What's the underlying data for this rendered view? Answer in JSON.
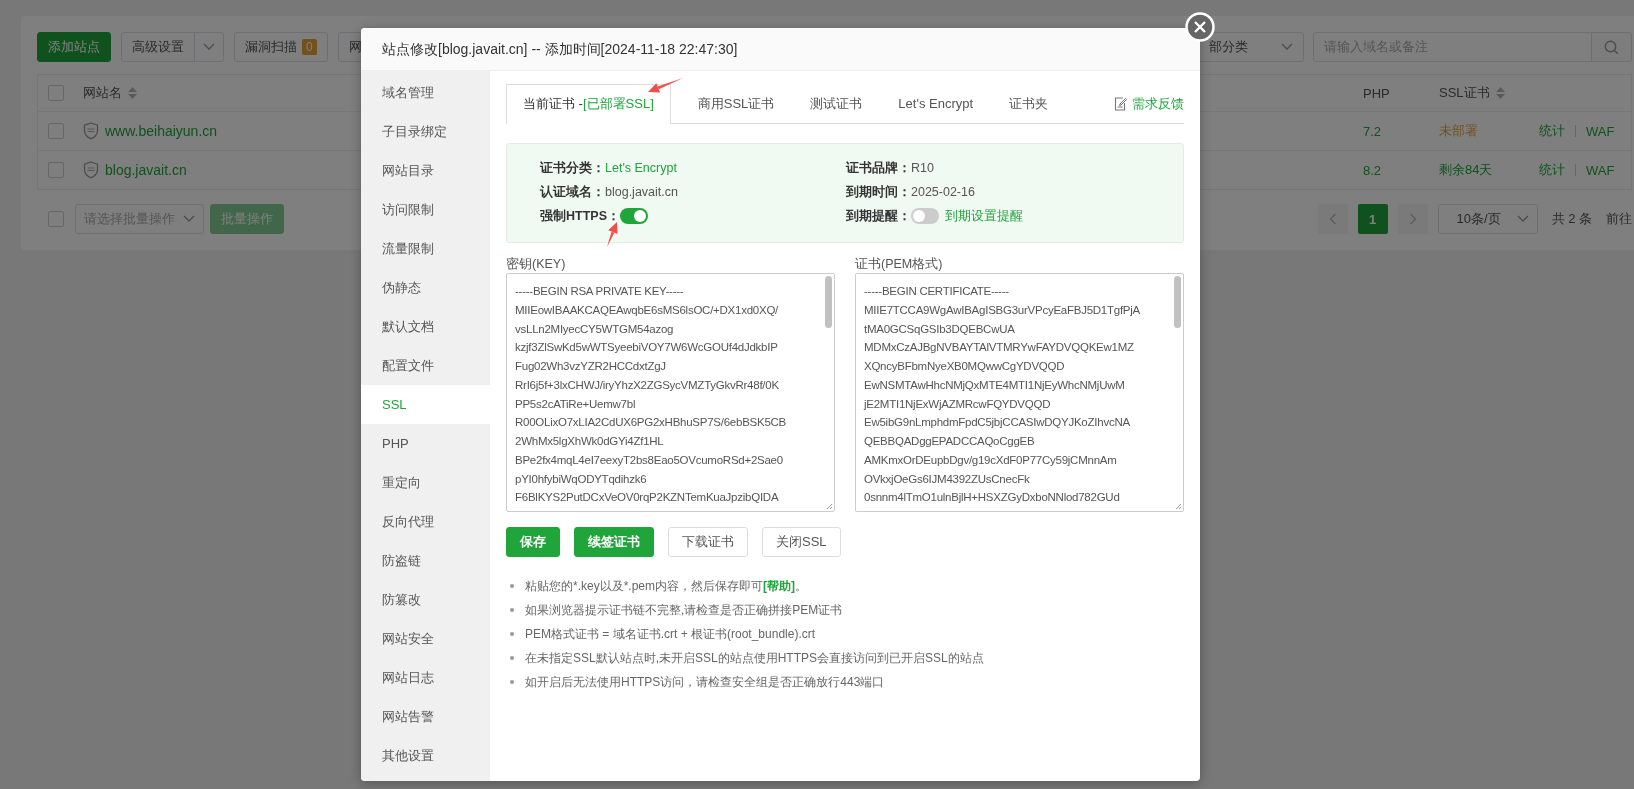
{
  "background": {
    "toolbar": {
      "buttons": [
        {
          "label": "添加站点",
          "kind": "primary"
        },
        {
          "label": "高级设置",
          "kind": "split"
        },
        {
          "label": "漏洞扫描",
          "kind": "badge",
          "badge": "0"
        },
        {
          "label": "网",
          "kind": "plain"
        }
      ],
      "category": "部分类",
      "search": {
        "placeholder": "请输入域名或备注"
      }
    },
    "table": {
      "select_all_checked": false,
      "columns": [
        {
          "label": "网站名",
          "sortable": true
        },
        {
          "label": "PHP",
          "sortable": false
        },
        {
          "label": "SSL证书",
          "sortable": true
        }
      ],
      "rows": [
        {
          "checked": false,
          "name": "www.beihaiyun.cn",
          "php": "7.2",
          "ssl": "未部署",
          "color": "#73511e",
          "actions": [
            "统计",
            "WAF"
          ]
        },
        {
          "checked": false,
          "name": "blog.javait.cn",
          "php": "8.2",
          "ssl": "剩余84天",
          "color": "#10521d",
          "actions": [
            "统计",
            "WAF"
          ]
        }
      ]
    },
    "footer": {
      "select_all_checked": false,
      "batch_placeholder": "请选择批量操作",
      "batch_button": {
        "label": "批量操作",
        "disabled": true
      },
      "pages": [
        {
          "label": "1",
          "selected": true
        }
      ],
      "page_size": "10条/页",
      "total": "共 2 条",
      "goto": "前往"
    }
  },
  "modal": {
    "title": "站点修改[blog.javait.cn] -- 添加时间[2024-11-18 22:47:30]",
    "sidebar": {
      "items": [
        {
          "label": "域名管理",
          "selected": false
        },
        {
          "label": "子目录绑定",
          "selected": false
        },
        {
          "label": "网站目录",
          "selected": false
        },
        {
          "label": "访问限制",
          "selected": false
        },
        {
          "label": "流量限制",
          "selected": false
        },
        {
          "label": "伪静态",
          "selected": false
        },
        {
          "label": "默认文档",
          "selected": false
        },
        {
          "label": "配置文件",
          "selected": false
        },
        {
          "label": "SSL",
          "selected": true
        },
        {
          "label": "PHP",
          "selected": false
        },
        {
          "label": "重定向",
          "selected": false
        },
        {
          "label": "反向代理",
          "selected": false
        },
        {
          "label": "防盗链",
          "selected": false
        },
        {
          "label": "防篡改",
          "selected": false
        },
        {
          "label": "网站安全",
          "selected": false
        },
        {
          "label": "网站日志",
          "selected": false
        },
        {
          "label": "网站告警",
          "selected": false
        },
        {
          "label": "其他设置",
          "selected": false
        }
      ]
    },
    "tabs": [
      {
        "label": "当前证书 -",
        "status": "[已部署SSL]",
        "selected": true
      },
      {
        "label": "商用SSL证书",
        "selected": false
      },
      {
        "label": "测试证书",
        "selected": false
      },
      {
        "label": "Let's Encrypt",
        "selected": false
      },
      {
        "label": "证书夹",
        "selected": false
      }
    ],
    "feedback": "需求反馈",
    "info": [
      {
        "kind": "text",
        "label": "证书分类：",
        "value": "Let's Encrypt",
        "accent": true
      },
      {
        "kind": "text",
        "label": "证书品牌：",
        "value": "R10",
        "accent": false
      },
      {
        "kind": "text",
        "label": "认证域名：",
        "value": "blog.javait.cn",
        "accent": false
      },
      {
        "kind": "text",
        "label": "到期时间：",
        "value": "2025-02-16",
        "accent": false
      },
      {
        "kind": "toggle",
        "label": "强制HTTPS：",
        "on": true
      },
      {
        "kind": "toggle",
        "label": "到期提醒：",
        "on": false,
        "link": "到期设置提醒"
      }
    ],
    "key": {
      "label": "密钥(KEY)",
      "lines": [
        "-----BEGIN RSA PRIVATE KEY-----",
        "MIIEowIBAAKCAQEAwqbE6sMS6lsOC/+DX1xd0XQ/",
        "vsLLn2MIyecCY5WTGM54azog",
        "kzjf3ZlSwKd5wWTSyeebiVOY7W6WcGOUf4dJdkbIP",
        "Fug02Wh3vzYZR2HCCdxtZgJ",
        "RrI6j5f+3lxCHWJ/iryYhzX2ZGSycVMZTyGkvRr48f/0K",
        "PP5s2cATiRe+Uemw7bl",
        "R00OLixO7xLIA2CdUX6PG2xHBhuSP7S/6ebBSK5CB",
        "2WhMx5lgXhWk0dGYi4Zf1HL",
        "BPe2fx4mqL4eI7eexyT2bs8Eao5OVcumoRSd+2Sae0",
        "pYI0hfybiWqODYTqdihzk6",
        "F6BlKYS2PutDCxVeOV0rqP2KZNTemKuaJpzibQIDA"
      ]
    },
    "cert": {
      "label": "证书(PEM格式)",
      "lines": [
        "-----BEGIN CERTIFICATE-----",
        "MIIE7TCCA9WgAwIBAgISBG3urVPcyEaFBJ5D1TgfPjA",
        "tMA0GCSqGSIb3DQEBCwUA",
        "MDMxCzAJBgNVBAYTAlVTMRYwFAYDVQQKEw1MZ",
        "XQncyBFbmNyeXB0MQwwCgYDVQQD",
        "EwNSMTAwHhcNMjQxMTE4MTI1NjEyWhcNMjUwM",
        "jE2MTI1NjExWjAZMRcwFQYDVQQD",
        "Ew5ibG9nLmphdmFpdC5jbjCCASIwDQYJKoZIhvcNA",
        "QEBBQADggEPADCCAQoCggEB",
        "AMKmxOrDEupbDgv/g19cXdF0P77Cy59jCMnnAm",
        "OVkxjOeGs6IJM4392ZUsCnecFk",
        "0snnm4lTmO1ulnBjlH+HSXZGyDxboNNlod782GUd"
      ]
    },
    "buttons": [
      {
        "label": "保存",
        "kind": "primary"
      },
      {
        "label": "续签证书",
        "kind": "primary"
      },
      {
        "label": "下载证书",
        "kind": "plain"
      },
      {
        "label": "关闭SSL",
        "kind": "plain"
      }
    ],
    "notes": [
      {
        "text": "粘贴您的*.key以及*.pem内容，然后保存即可",
        "link": "[帮助]",
        "tail": "。"
      },
      {
        "text": "如果浏览器提示证书链不完整,请检查是否正确拼接PEM证书"
      },
      {
        "text": "PEM格式证书 = 域名证书.crt + 根证书(root_bundle).crt"
      },
      {
        "text": "在未指定SSL默认站点时,未开启SSL的站点使用HTTPS会直接访问到已开启SSL的站点"
      },
      {
        "text": "如开启后无法使用HTTPS访问，请检查安全组是否正确放行443端口"
      }
    ]
  },
  "annotations": [
    {
      "kind": "arrow"
    },
    {
      "kind": "arrow"
    }
  ]
}
